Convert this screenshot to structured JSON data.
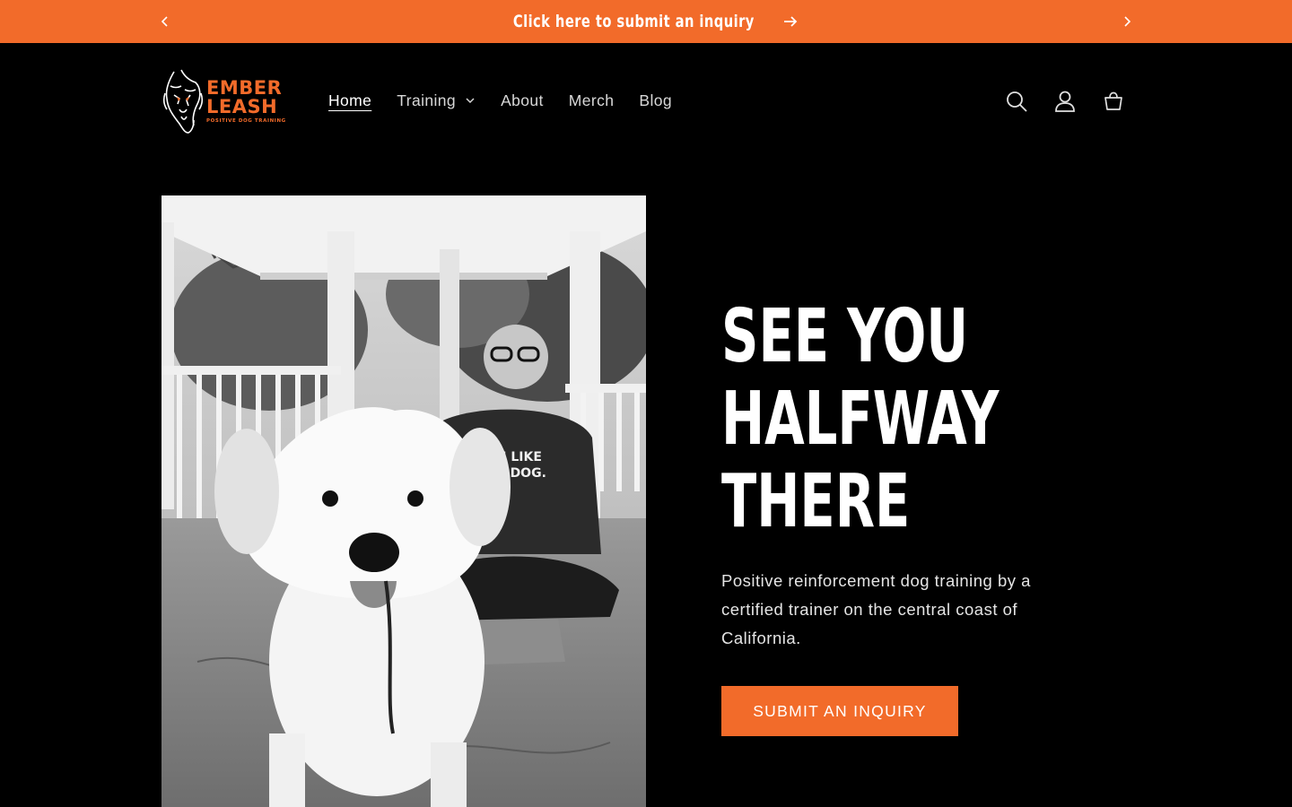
{
  "colors": {
    "accent": "#f26b2a",
    "background": "#000000",
    "text": "#ffffff"
  },
  "announcement": {
    "text": "Click here to submit an inquiry",
    "prev_icon": "chevron-left-icon",
    "next_icon": "chevron-right-icon",
    "arrow_icon": "arrow-right-icon"
  },
  "logo": {
    "line1": "EMBER",
    "line2": "LEASH",
    "tagline": "POSITIVE DOG TRAINING"
  },
  "nav": {
    "items": [
      {
        "label": "Home",
        "active": true
      },
      {
        "label": "Training",
        "has_dropdown": true
      },
      {
        "label": "About"
      },
      {
        "label": "Merch"
      },
      {
        "label": "Blog"
      }
    ]
  },
  "header_icons": [
    "search-icon",
    "account-icon",
    "cart-icon"
  ],
  "hero": {
    "title_lines": [
      "SEE YOU",
      "HALFWAY",
      "THERE"
    ],
    "description": "Positive reinforcement dog training by a certified trainer on the central coast of California.",
    "cta_label": "SUBMIT AN INQUIRY",
    "image_shirt_text": "HEY, I LIKE YOUR DOG."
  }
}
